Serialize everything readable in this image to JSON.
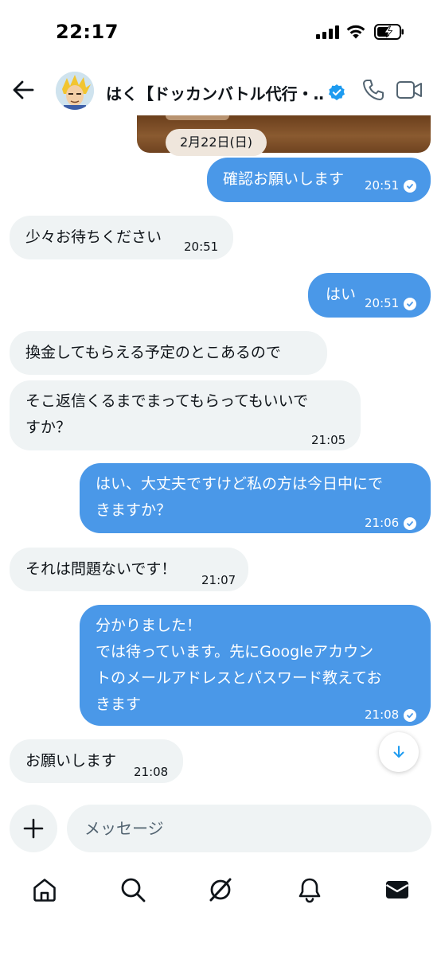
{
  "status_bar": {
    "time": "22:17"
  },
  "header": {
    "contact_name": "はく【ドッカンバトル代行・…",
    "icons": [
      "back-arrow-icon",
      "verified-badge-icon",
      "phone-icon",
      "video-call-icon"
    ]
  },
  "chat": {
    "date_label": "2月22日(日)",
    "messages": [
      {
        "direction": "sent",
        "text": "確認お願いします",
        "time": "20:51",
        "read": true
      },
      {
        "direction": "received",
        "text": "少々お待ちください",
        "time": "20:51"
      },
      {
        "direction": "sent",
        "text": "はい",
        "time": "20:51",
        "read": true
      },
      {
        "direction": "received",
        "text": "換金してもらえる予定のとこあるので",
        "time": ""
      },
      {
        "direction": "received",
        "text": "そこ返信くるまでまってもらってもいいで\nすか？",
        "time": "21:05"
      },
      {
        "direction": "sent",
        "text": "はい、大丈夫ですけど私の方は今日中にで\nきますか？",
        "time": "21:06",
        "read": true
      },
      {
        "direction": "received",
        "text": "それは問題ないです！",
        "time": "21:07"
      },
      {
        "direction": "sent",
        "text": "分かりました！\nでは待っています。先にGoogleアカウン\nトのメールアドレスとパスワード教えてお\nきます",
        "time": "21:08",
        "read": true
      },
      {
        "direction": "received",
        "text": "お願いします",
        "time": "21:08"
      }
    ]
  },
  "composer": {
    "placeholder": "メッセージ"
  },
  "bottom_nav": [
    "home-icon",
    "search-icon",
    "grok-icon",
    "notifications-icon",
    "messages-icon"
  ],
  "colors": {
    "sent_bubble": "#4a98e8",
    "received_bubble": "#eff3f4",
    "accent": "#1d9bf0",
    "date_chip": "#efe6dc"
  }
}
